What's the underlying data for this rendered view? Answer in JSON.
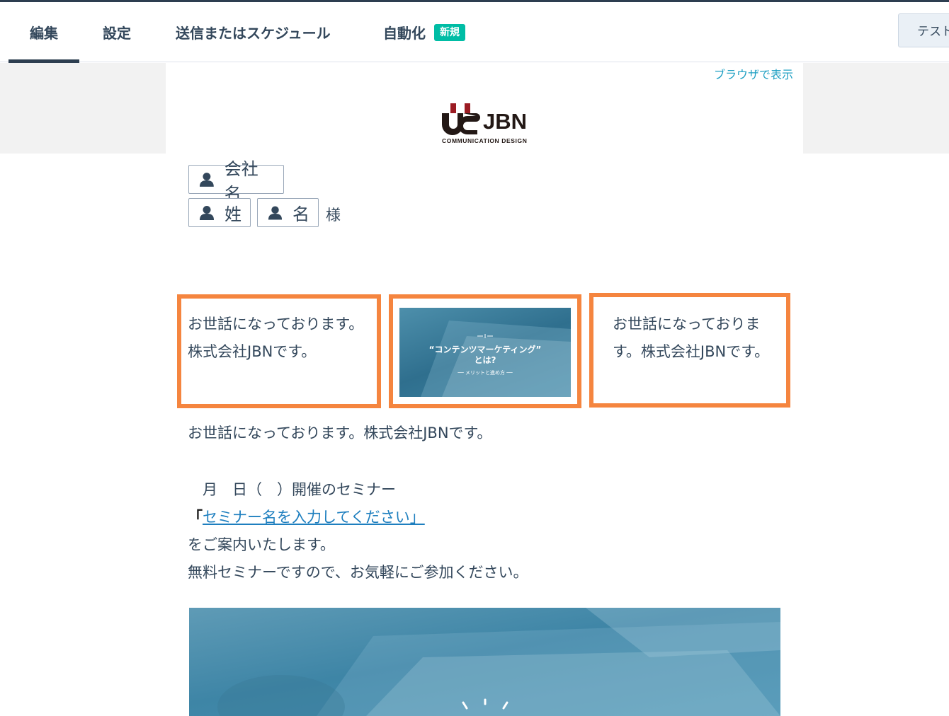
{
  "tabs": {
    "edit": "編集",
    "settings": "設定",
    "send": "送信またはスケジュール",
    "automation": "自動化",
    "automation_badge": "新規"
  },
  "toolbar": {
    "test_label": "テスト"
  },
  "email": {
    "view_in_browser": "ブラウザで表示",
    "logo": {
      "brand": "JBN",
      "tagline": "COMMUNICATION DESIGN"
    },
    "tokens": {
      "company": "会社名",
      "last_name": "姓",
      "first_name": "名"
    },
    "honorific": "様",
    "modules": {
      "left_text": "お世話になっております。株式会社JBNです。",
      "thumbnail_title_line1": "“コンテンツマーケティング”",
      "thumbnail_title_line2": "とは?",
      "thumbnail_subtitle": "── メリットと進め方 ──",
      "right_text": "お世話になっております。株式会社JBNです。"
    },
    "body": {
      "greeting": "お世話になっております。株式会社JBNです。",
      "date_line": "　月　日（　）開催のセミナー",
      "open_bracket": "「",
      "seminar_link": "セミナー名を入力してください」",
      "line_invite": "をご案内いたします。",
      "line_free": "無料セミナーですので、お気軽にご参加ください。"
    }
  },
  "colors": {
    "accent_orange": "#f5853f",
    "badge_teal": "#00bda5",
    "link_blue": "#1e7fbf",
    "nav_dark": "#2d3e50"
  }
}
